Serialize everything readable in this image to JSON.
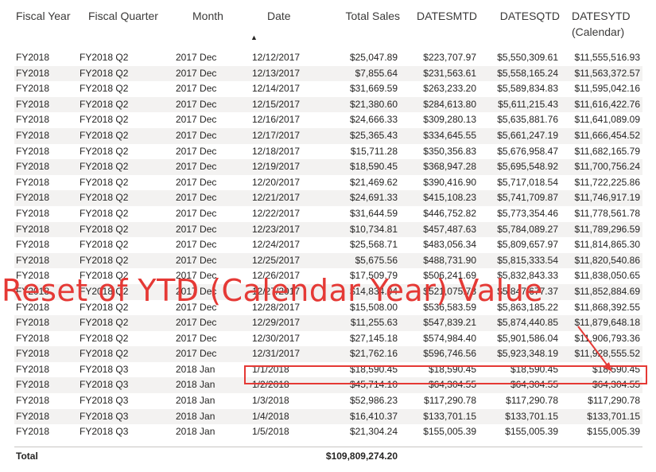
{
  "headers": {
    "fiscal_year": "Fiscal Year",
    "fiscal_quarter": "Fiscal Quarter",
    "month": "Month",
    "date": "Date",
    "total_sales": "Total Sales",
    "datesmtd": "DATESMTD",
    "datesqtd": "DATESQTD",
    "datesytd_line1": "DATESYTD",
    "datesytd_line2": "(Calendar)"
  },
  "sort_indicator": "▲",
  "rows": [
    [
      "FY2018",
      "FY2018 Q2",
      "2017 Dec",
      "12/12/2017",
      "$25,047.89",
      "$223,707.97",
      "$5,550,309.61",
      "$11,555,516.93"
    ],
    [
      "FY2018",
      "FY2018 Q2",
      "2017 Dec",
      "12/13/2017",
      "$7,855.64",
      "$231,563.61",
      "$5,558,165.24",
      "$11,563,372.57"
    ],
    [
      "FY2018",
      "FY2018 Q2",
      "2017 Dec",
      "12/14/2017",
      "$31,669.59",
      "$263,233.20",
      "$5,589,834.83",
      "$11,595,042.16"
    ],
    [
      "FY2018",
      "FY2018 Q2",
      "2017 Dec",
      "12/15/2017",
      "$21,380.60",
      "$284,613.80",
      "$5,611,215.43",
      "$11,616,422.76"
    ],
    [
      "FY2018",
      "FY2018 Q2",
      "2017 Dec",
      "12/16/2017",
      "$24,666.33",
      "$309,280.13",
      "$5,635,881.76",
      "$11,641,089.09"
    ],
    [
      "FY2018",
      "FY2018 Q2",
      "2017 Dec",
      "12/17/2017",
      "$25,365.43",
      "$334,645.55",
      "$5,661,247.19",
      "$11,666,454.52"
    ],
    [
      "FY2018",
      "FY2018 Q2",
      "2017 Dec",
      "12/18/2017",
      "$15,711.28",
      "$350,356.83",
      "$5,676,958.47",
      "$11,682,165.79"
    ],
    [
      "FY2018",
      "FY2018 Q2",
      "2017 Dec",
      "12/19/2017",
      "$18,590.45",
      "$368,947.28",
      "$5,695,548.92",
      "$11,700,756.24"
    ],
    [
      "FY2018",
      "FY2018 Q2",
      "2017 Dec",
      "12/20/2017",
      "$21,469.62",
      "$390,416.90",
      "$5,717,018.54",
      "$11,722,225.86"
    ],
    [
      "FY2018",
      "FY2018 Q2",
      "2017 Dec",
      "12/21/2017",
      "$24,691.33",
      "$415,108.23",
      "$5,741,709.87",
      "$11,746,917.19"
    ],
    [
      "FY2018",
      "FY2018 Q2",
      "2017 Dec",
      "12/22/2017",
      "$31,644.59",
      "$446,752.82",
      "$5,773,354.46",
      "$11,778,561.78"
    ],
    [
      "FY2018",
      "FY2018 Q2",
      "2017 Dec",
      "12/23/2017",
      "$10,734.81",
      "$457,487.63",
      "$5,784,089.27",
      "$11,789,296.59"
    ],
    [
      "FY2018",
      "FY2018 Q2",
      "2017 Dec",
      "12/24/2017",
      "$25,568.71",
      "$483,056.34",
      "$5,809,657.97",
      "$11,814,865.30"
    ],
    [
      "FY2018",
      "FY2018 Q2",
      "2017 Dec",
      "12/25/2017",
      "$5,675.56",
      "$488,731.90",
      "$5,815,333.54",
      "$11,820,540.86"
    ],
    [
      "FY2018",
      "FY2018 Q2",
      "2017 Dec",
      "12/26/2017",
      "$17,509.79",
      "$506,241.69",
      "$5,832,843.33",
      "$11,838,050.65"
    ],
    [
      "FY2018",
      "FY2018 Q2",
      "2017 Dec",
      "12/27/2017",
      "$14,834.04",
      "$521,075.73",
      "$5,847,677.37",
      "$11,852,884.69"
    ],
    [
      "FY2018",
      "FY2018 Q2",
      "2017 Dec",
      "12/28/2017",
      "$15,508.00",
      "$536,583.59",
      "$5,863,185.22",
      "$11,868,392.55"
    ],
    [
      "FY2018",
      "FY2018 Q2",
      "2017 Dec",
      "12/29/2017",
      "$11,255.63",
      "$547,839.21",
      "$5,874,440.85",
      "$11,879,648.18"
    ],
    [
      "FY2018",
      "FY2018 Q2",
      "2017 Dec",
      "12/30/2017",
      "$27,145.18",
      "$574,984.40",
      "$5,901,586.04",
      "$11,906,793.36"
    ],
    [
      "FY2018",
      "FY2018 Q2",
      "2017 Dec",
      "12/31/2017",
      "$21,762.16",
      "$596,746.56",
      "$5,923,348.19",
      "$11,928,555.52"
    ],
    [
      "FY2018",
      "FY2018 Q3",
      "2018 Jan",
      "1/1/2018",
      "$18,590.45",
      "$18,590.45",
      "$18,590.45",
      "$18,590.45"
    ],
    [
      "FY2018",
      "FY2018 Q3",
      "2018 Jan",
      "1/2/2018",
      "$45,714.10",
      "$64,304.55",
      "$64,304.55",
      "$64,304.55"
    ],
    [
      "FY2018",
      "FY2018 Q3",
      "2018 Jan",
      "1/3/2018",
      "$52,986.23",
      "$117,290.78",
      "$117,290.78",
      "$117,290.78"
    ],
    [
      "FY2018",
      "FY2018 Q3",
      "2018 Jan",
      "1/4/2018",
      "$16,410.37",
      "$133,701.15",
      "$133,701.15",
      "$133,701.15"
    ],
    [
      "FY2018",
      "FY2018 Q3",
      "2018 Jan",
      "1/5/2018",
      "$21,304.24",
      "$155,005.39",
      "$155,005.39",
      "$155,005.39"
    ]
  ],
  "total": {
    "label": "Total",
    "total_sales": "$109,809,274.20"
  },
  "annotation": {
    "text": "Reset of YTD (Calendar Year) Value",
    "color": "#e53935"
  },
  "colors": {
    "stripe": "#f3f2f1",
    "text": "#252423",
    "accent_red": "#e53935"
  }
}
